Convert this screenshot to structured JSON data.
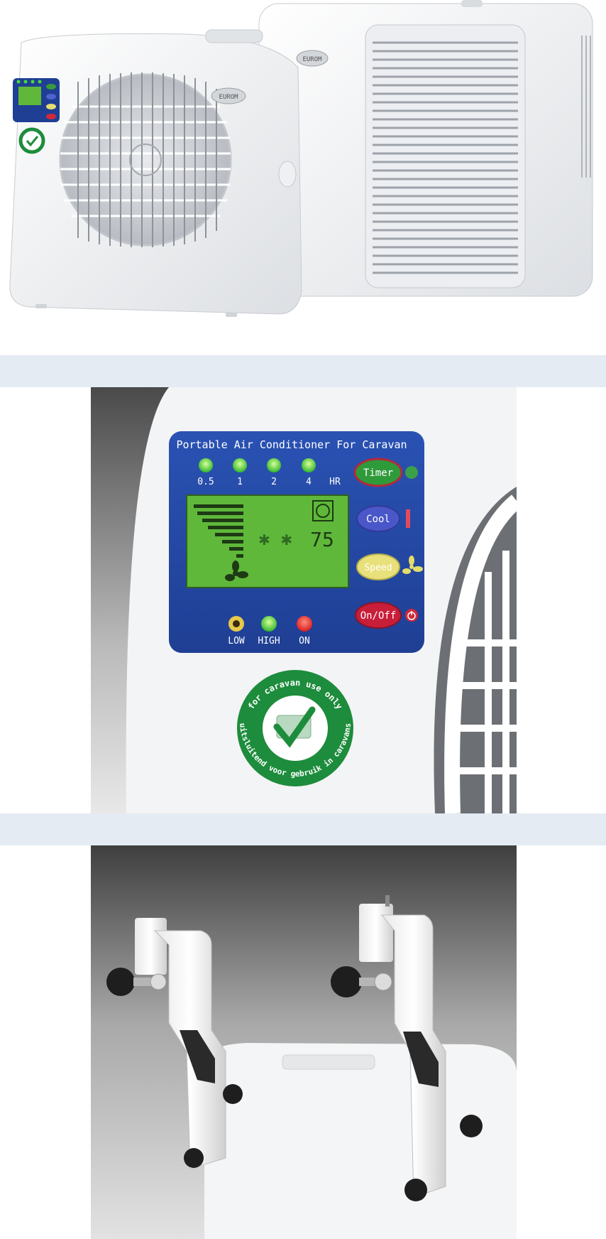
{
  "brand": {
    "logo_text": "EUROM"
  },
  "panel": {
    "title": "Portable Air Conditioner For Caravan",
    "timer_labels": [
      "0.5",
      "1",
      "2",
      "4",
      "HR"
    ],
    "lcd_temp": "75",
    "lcd_fan_glyph": "✱ ✱",
    "buttons": {
      "timer": "Timer",
      "cool": "Cool",
      "speed": "Speed",
      "onoff": "On/Off"
    },
    "indicator_labels": {
      "low": "LOW",
      "high": "HIGH",
      "on": "ON"
    }
  },
  "badge": {
    "outer_top": "for caravan use only",
    "outer_bottom": "uitsluitend voor gebruik in caravans"
  },
  "colors": {
    "panel_blue": "#1f3f94",
    "lcd_green": "#5fb83a",
    "led_green": "#4ad83a",
    "led_red": "#e52a2a",
    "badge_green": "#1d8c3c",
    "separator": "#e4ebf3"
  }
}
